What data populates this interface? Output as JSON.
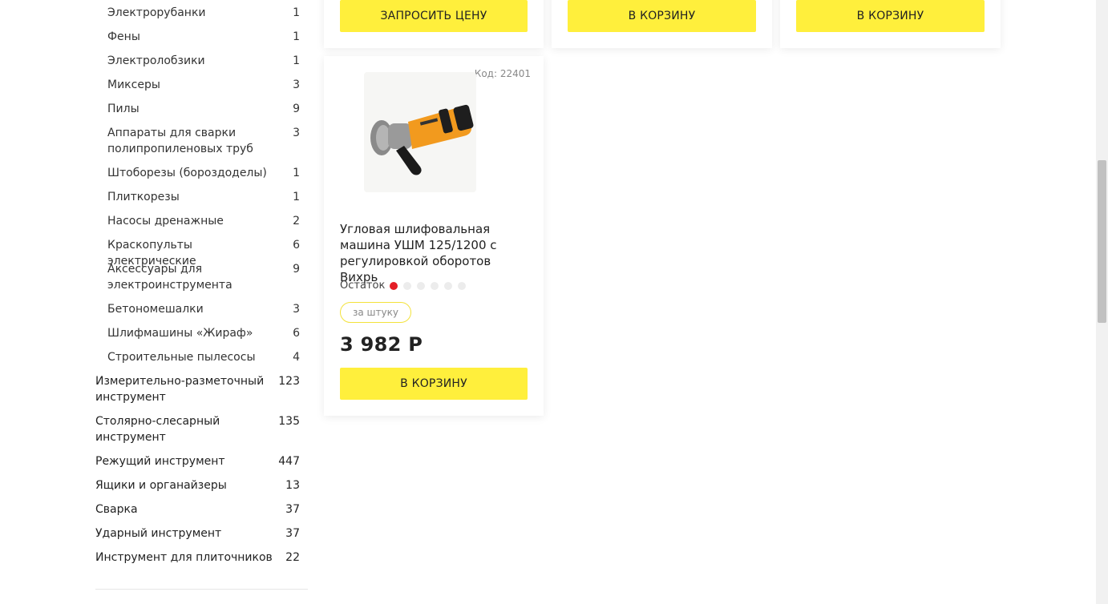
{
  "sidebar": {
    "subcategories": [
      {
        "label": "Электрорубанки",
        "count": "1"
      },
      {
        "label": "Фены",
        "count": "1"
      },
      {
        "label": "Электролобзики",
        "count": "1"
      },
      {
        "label": "Миксеры",
        "count": "3"
      },
      {
        "label": "Пилы",
        "count": "9"
      },
      {
        "label": "Аппараты для сварки полипропиленовых труб",
        "count": "3"
      },
      {
        "label": "Штоборезы (бороздоделы)",
        "count": "1"
      },
      {
        "label": "Плиткорезы",
        "count": "1"
      },
      {
        "label": "Насосы дренажные",
        "count": "2"
      },
      {
        "label": "Краскопульты электрические",
        "count": "6"
      },
      {
        "label": "Аксессуары для электроинструмента",
        "count": "9"
      },
      {
        "label": "Бетономешалки",
        "count": "3"
      },
      {
        "label": "Шлифмашины «Жираф»",
        "count": "6"
      },
      {
        "label": "Строительные пылесосы",
        "count": "4"
      }
    ],
    "categories": [
      {
        "label": "Измерительно-разметочный инструмент",
        "count": "123"
      },
      {
        "label": "Столярно-слесарный инструмент",
        "count": "135"
      },
      {
        "label": "Режущий инструмент",
        "count": "447"
      },
      {
        "label": "Ящики и органайзеры",
        "count": "13"
      },
      {
        "label": "Сварка",
        "count": "37"
      },
      {
        "label": "Ударный инструмент",
        "count": "37"
      },
      {
        "label": "Инструмент для плиточников",
        "count": "22"
      }
    ]
  },
  "top_cards": [
    {
      "button": "ЗАПРОСИТЬ ЦЕНУ"
    },
    {
      "button": "В КОРЗИНУ"
    },
    {
      "button": "В КОРЗИНУ"
    }
  ],
  "product": {
    "code": "Код: 22401",
    "title": "Угловая шлифовальная машина УШМ 125/1200 с регулировкой оборотов Вихрь",
    "stock_label": "Остаток",
    "stock_level": 1,
    "stock_max": 6,
    "unit": "за штуку",
    "price": "3 982 Р",
    "button": "В КОРЗИНУ"
  },
  "colors": {
    "accent": "#ffef3c",
    "stock_on": "#e41e26",
    "stock_off": "#ececec"
  },
  "icons": [
    "angle-grinder-image"
  ]
}
